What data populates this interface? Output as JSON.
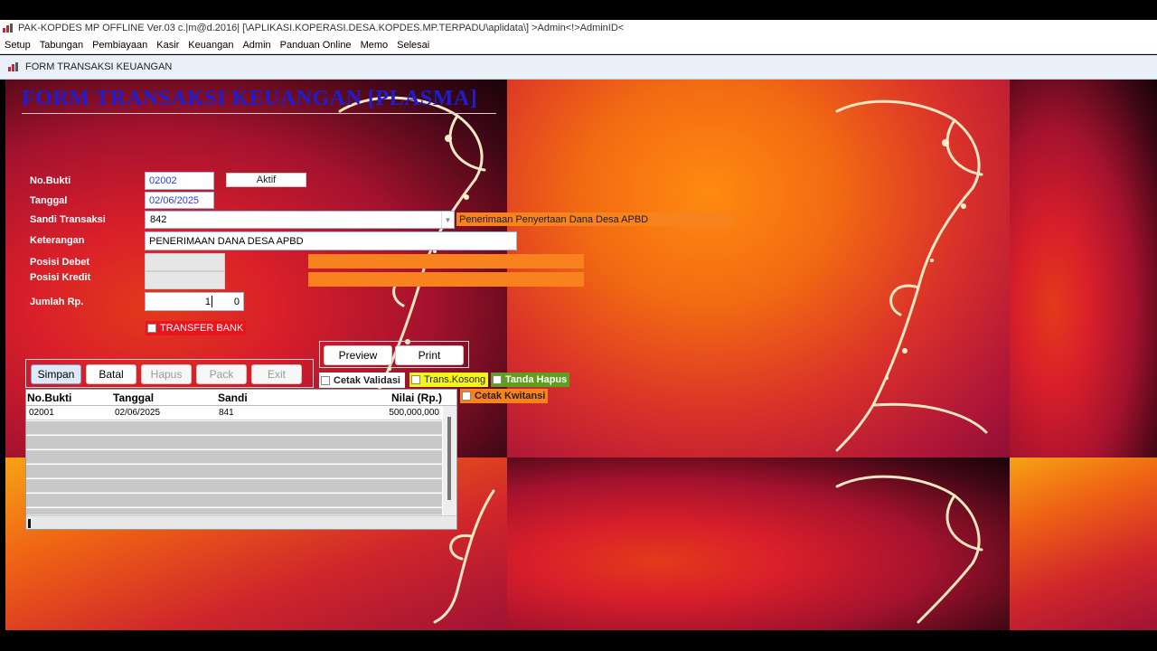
{
  "window": {
    "title": "PAK-KOPDES MP OFFLINE Ver.03 c.|m@d.2016| [\\APLIKASI.KOPERASI.DESA.KOPDES.MP.TERPADU\\aplidata\\] >Admin<!>AdminID<"
  },
  "menu": {
    "items": [
      "Setup",
      "Tabungan",
      "Pembiayaan",
      "Kasir",
      "Keuangan",
      "Admin",
      "Panduan Online",
      "Memo",
      "Selesai"
    ]
  },
  "child_window": {
    "title": "FORM TRANSAKSI KEUANGAN"
  },
  "form": {
    "heading": "FORM TRANSAKSI KEUANGAN [PLASMA]",
    "labels": {
      "no_bukti": "No.Bukti",
      "tanggal": "Tanggal",
      "sandi": "Sandi Transaksi",
      "keterangan": "Keterangan",
      "debet": "Posisi Debet",
      "kredit": "Posisi Kredit",
      "jumlah": "Jumlah Rp."
    },
    "no_bukti": "02002",
    "status": "Aktif",
    "tanggal": "02/06/2025",
    "sandi": "842",
    "sandi_desc": "Penerimaan Penyertaan Dana Desa APBD",
    "keterangan": "PENERIMAAN DANA DESA APBD",
    "posisi_debet": "",
    "posisi_kredit": "",
    "jumlah_int": "1",
    "jumlah_dec": "0",
    "transfer_bank": "TRANSFER BANK"
  },
  "buttons": {
    "simpan": "Simpan",
    "batal": "Batal",
    "hapus": "Hapus",
    "pack": "Pack",
    "exit": "Exit",
    "preview": "Preview",
    "print": "Print"
  },
  "options": {
    "cetak_validasi": "Cetak Validasi",
    "trans_kosong": "Trans.Kosong",
    "tanda_hapus": "Tanda Hapus",
    "cetak_kwitansi": "Cetak Kwitansi"
  },
  "colors": {
    "heading": "#1d1dd6",
    "orange": "#f7821e",
    "yellow": "#f5f51a",
    "green": "#5f9e1f",
    "red_check": "#e8141e"
  },
  "table": {
    "columns": [
      "No.Bukti",
      "Tanggal",
      "Sandi",
      "Nilai (Rp.)"
    ],
    "rows": [
      {
        "no_bukti": "02001",
        "tanggal": "02/06/2025",
        "sandi": "841",
        "nilai": "500,000,000"
      }
    ]
  }
}
